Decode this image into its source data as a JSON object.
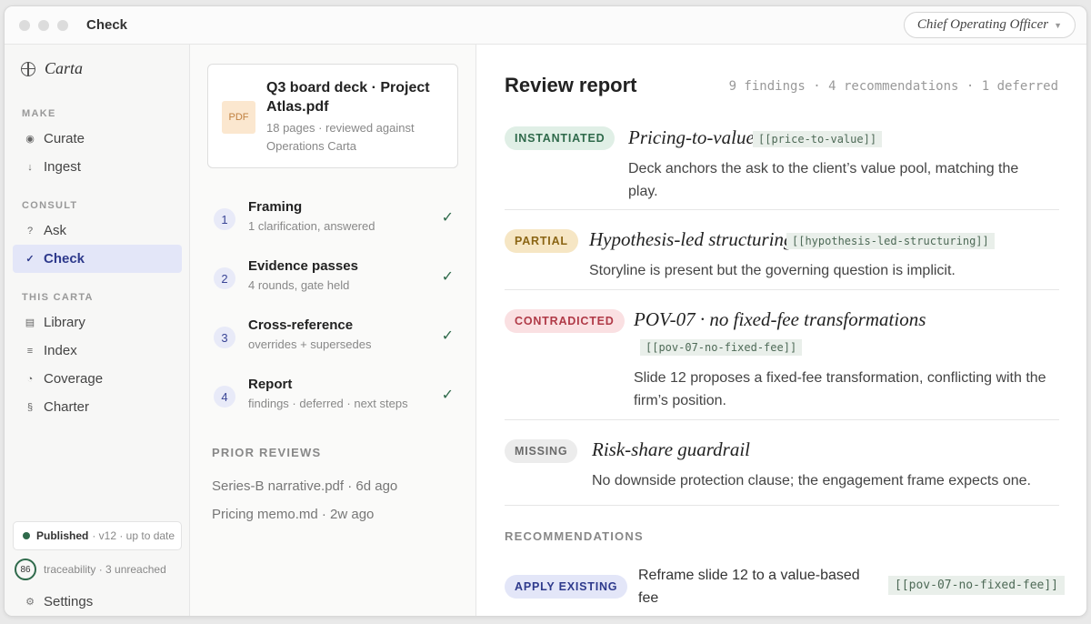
{
  "window": {
    "title": "Check",
    "role_selector": {
      "value": "Chief Operating Officer"
    }
  },
  "sidebar": {
    "brand": "Carta",
    "sections": [
      {
        "label": "MAKE",
        "items": [
          {
            "icon": "sparkle-icon",
            "glyph": "◉",
            "label": "Curate"
          },
          {
            "icon": "arrow-down-icon",
            "glyph": "↓",
            "label": "Ingest"
          }
        ]
      },
      {
        "label": "CONSULT",
        "items": [
          {
            "icon": "question-icon",
            "glyph": "?",
            "label": "Ask"
          },
          {
            "icon": "check-icon",
            "glyph": "✓",
            "label": "Check",
            "active": true
          }
        ]
      },
      {
        "label": "THIS CARTA",
        "items": [
          {
            "icon": "library-icon",
            "glyph": "▤",
            "label": "Library"
          },
          {
            "icon": "index-icon",
            "glyph": "≡",
            "label": "Index"
          },
          {
            "icon": "coverage-icon",
            "glyph": "◔",
            "label": "Coverage"
          },
          {
            "icon": "section-icon",
            "glyph": "§",
            "label": "Charter"
          }
        ]
      }
    ],
    "status": {
      "state": "Published",
      "detail": "· v12 · up to date"
    },
    "traceability": {
      "score": "86",
      "text": "traceability · 3 unreached"
    },
    "settings": {
      "glyph": "⚙",
      "label": "Settings"
    }
  },
  "document": {
    "badge": "PDF",
    "title": "Q3 board deck · Project Atlas.pdf",
    "subtitle": "18 pages · reviewed against Operations Carta"
  },
  "steps": [
    {
      "num": "1",
      "title": "Framing",
      "sub": "1 clarification, answered"
    },
    {
      "num": "2",
      "title": "Evidence passes",
      "sub": "4 rounds, gate held"
    },
    {
      "num": "3",
      "title": "Cross-reference",
      "sub": "overrides + supersedes"
    },
    {
      "num": "4",
      "title": "Report",
      "sub": "findings · deferred · next steps"
    }
  ],
  "step_check_glyph": "✓",
  "prior_reviews": {
    "label": "PRIOR REVIEWS",
    "items": [
      "Series-B narrative.pdf · 6d ago",
      "Pricing memo.md · 2w ago"
    ]
  },
  "report": {
    "title": "Review report",
    "stats": "9 findings · 4 recommendations · 1 deferred",
    "findings": [
      {
        "status": "INSTANTIATED",
        "title": "Pricing-to-value",
        "tag": "[[price-to-value]]",
        "desc": "Deck anchors the ask to the client’s value pool, matching the play."
      },
      {
        "status": "PARTIAL",
        "title": "Hypothesis-led structuring",
        "tag": "[[hypothesis-led-structuring]]",
        "desc": "Storyline is present but the governing question is implicit."
      },
      {
        "status": "CONTRADICTED",
        "title": "POV-07 · no fixed-fee transformations",
        "tag": "[[pov-07-no-fixed-fee]]",
        "desc": "Slide 12 proposes a fixed-fee transformation, conflicting with the firm’s position."
      },
      {
        "status": "MISSING",
        "title": "Risk-share guardrail",
        "tag": "",
        "desc": "No downside protection clause; the engagement frame expects one."
      }
    ],
    "recommendations_label": "RECOMMENDATIONS",
    "recommendation": {
      "action": "APPLY EXISTING",
      "text": "Reframe slide 12 to a value-based fee",
      "tag": "[[pov-07-no-fixed-fee]]"
    }
  },
  "colors": {
    "accent": "#2e3a8c",
    "instantiated": "#2f6a4b",
    "partial": "#8b6514",
    "contradicted": "#b03a47",
    "missing": "#6a6a6a"
  }
}
